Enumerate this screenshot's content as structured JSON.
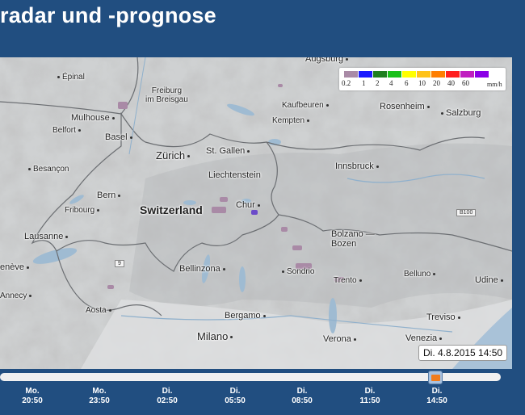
{
  "page": {
    "title": "radar und -prognose"
  },
  "legend": {
    "values": [
      "0.2",
      "1",
      "2",
      "4",
      "6",
      "10",
      "20",
      "40",
      "60"
    ],
    "unit": "mm/h",
    "colors": [
      "#a98aa6",
      "#1b1bff",
      "#1f7f1f",
      "#19c019",
      "#ffff00",
      "#ffc21a",
      "#ff7f00",
      "#ff1f1f",
      "#c01fc0",
      "#8a00e6"
    ]
  },
  "map": {
    "labels": {
      "augsburg": "Augsburg",
      "epinal": "Épinal",
      "freiburg": "Freiburg\nim Breisgau",
      "kaufbeuren": "Kaufbeuren",
      "rosenheim": "Rosenheim",
      "mulhouse": "Mulhouse",
      "kempten": "Kempten",
      "salzburg": "Salzburg",
      "basel": "Basel",
      "belfort": "Belfort",
      "zurich": "Zürich",
      "st_gallen": "St. Gallen",
      "besancon": "Besançon",
      "liechtenstein": "Liechtenstein",
      "innsbruck": "Innsbruck",
      "bern": "Bern",
      "chur": "Chur",
      "fribourg": "Fribourg",
      "switzerland": "Switzerland",
      "b100": "B100",
      "lausanne": "Lausanne",
      "bolzano": "Bolzano —\nBozen",
      "geneve": "enève",
      "bellinzona": "Bellinzona",
      "sondrio": "Sondrio",
      "trento": "Trento",
      "belluno": "Belluno",
      "udine": "Udine",
      "annecy": "Annecy",
      "aosta": "Aosta",
      "bergamo": "Bergamo",
      "treviso": "Treviso",
      "milano": "Milano",
      "verona": "Verona",
      "venezia": "Venezia",
      "road_9": "9"
    }
  },
  "timestamp": "Di. 4.8.2015 14:50",
  "timeline": {
    "progress": 0.87,
    "ticks": [
      {
        "day": "Mo.",
        "time": "20:50"
      },
      {
        "day": "Mo.",
        "time": "23:50"
      },
      {
        "day": "Di.",
        "time": "02:50"
      },
      {
        "day": "Di.",
        "time": "05:50"
      },
      {
        "day": "Di.",
        "time": "08:50"
      },
      {
        "day": "Di.",
        "time": "11:50"
      },
      {
        "day": "Di.",
        "time": "14:50"
      }
    ]
  }
}
